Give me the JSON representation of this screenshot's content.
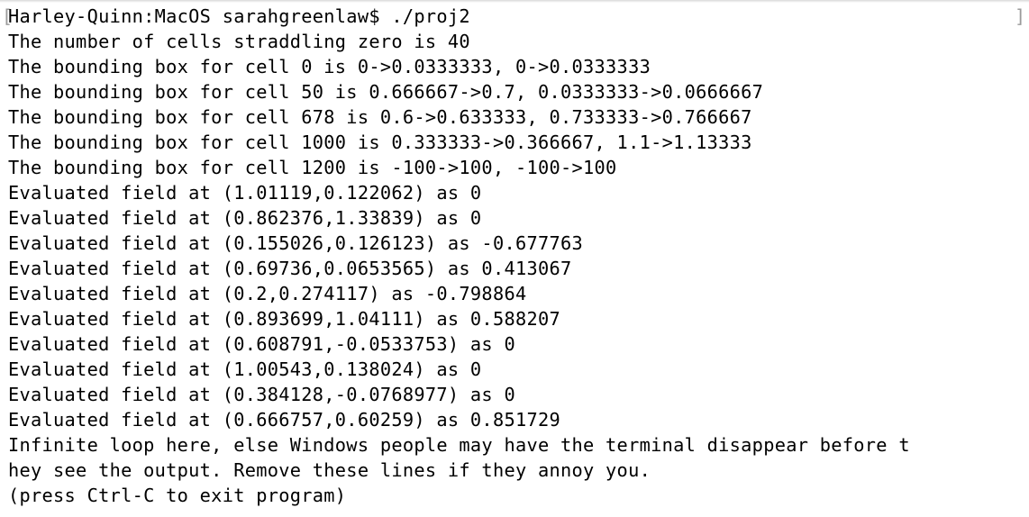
{
  "terminal": {
    "left_bracket": "[",
    "right_bracket": "]",
    "lines": [
      "Harley-Quinn:MacOS sarahgreenlaw$ ./proj2",
      "The number of cells straddling zero is 40",
      "The bounding box for cell 0 is 0->0.0333333, 0->0.0333333",
      "The bounding box for cell 50 is 0.666667->0.7, 0.0333333->0.0666667",
      "The bounding box for cell 678 is 0.6->0.633333, 0.733333->0.766667",
      "The bounding box for cell 1000 is 0.333333->0.366667, 1.1->1.13333",
      "The bounding box for cell 1200 is -100->100, -100->100",
      "Evaluated field at (1.01119,0.122062) as 0",
      "Evaluated field at (0.862376,1.33839) as 0",
      "Evaluated field at (0.155026,0.126123) as -0.677763",
      "Evaluated field at (0.69736,0.0653565) as 0.413067",
      "Evaluated field at (0.2,0.274117) as -0.798864",
      "Evaluated field at (0.893699,1.04111) as 0.588207",
      "Evaluated field at (0.608791,-0.0533753) as 0",
      "Evaluated field at (1.00543,0.138024) as 0",
      "Evaluated field at (0.384128,-0.0768977) as 0",
      "Evaluated field at (0.666757,0.60259) as 0.851729",
      "Infinite loop here, else Windows people may have the terminal disappear before t",
      "hey see the output. Remove these lines if they annoy you.",
      "(press Ctrl-C to exit program)"
    ]
  }
}
